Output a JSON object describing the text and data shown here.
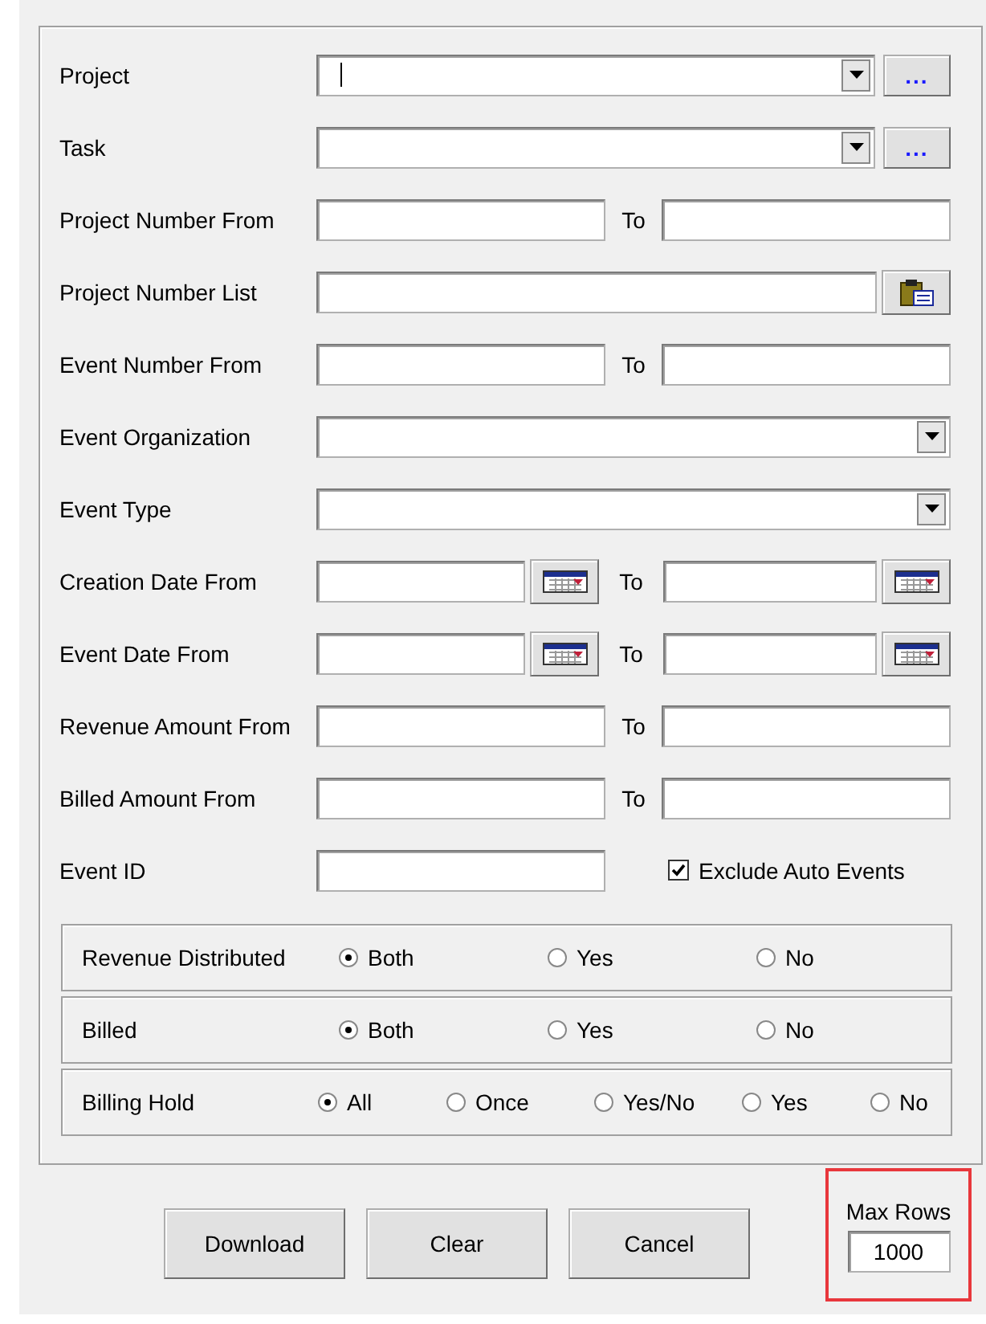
{
  "fields": [
    {
      "kind": "combo",
      "label": "Project",
      "browse": "...",
      "focused": true
    },
    {
      "kind": "combo",
      "label": "Task",
      "browse": "...",
      "focused": false
    },
    {
      "kind": "range",
      "label": "Project Number From",
      "to_label": "To",
      "focused": false
    },
    {
      "kind": "list",
      "label": "Project Number List",
      "focused": false
    },
    {
      "kind": "range",
      "label": "Event Number From",
      "to_label": "To",
      "focused": false
    },
    {
      "kind": "combo",
      "label": "Event Organization",
      "focused": false
    },
    {
      "kind": "combo",
      "label": "Event Type",
      "focused": false
    },
    {
      "kind": "date_range",
      "label": "Creation Date From",
      "to_label": "To",
      "focused": false
    },
    {
      "kind": "date_range",
      "label": "Event Date From",
      "to_label": "To",
      "focused": false
    },
    {
      "kind": "range",
      "label": "Revenue Amount From",
      "to_label": "To",
      "focused": false
    },
    {
      "kind": "range",
      "label": "Billed Amount From",
      "to_label": "To",
      "focused": false
    },
    {
      "kind": "single",
      "label": "Event ID",
      "focused": false,
      "checkbox": {
        "label": "Exclude Auto Events",
        "checked": true
      }
    }
  ],
  "radio_groups": [
    {
      "label": "Revenue Distributed",
      "options": [
        {
          "label": "Both",
          "selected": true
        },
        {
          "label": "Yes",
          "selected": false
        },
        {
          "label": "No",
          "selected": false
        }
      ]
    },
    {
      "label": "Billed",
      "options": [
        {
          "label": "Both",
          "selected": true
        },
        {
          "label": "Yes",
          "selected": false
        },
        {
          "label": "No",
          "selected": false
        }
      ]
    },
    {
      "label": "Billing Hold",
      "options": [
        {
          "label": "All",
          "selected": true
        },
        {
          "label": "Once",
          "selected": false
        },
        {
          "label": "Yes/No",
          "selected": false
        },
        {
          "label": "Yes",
          "selected": false
        },
        {
          "label": "No",
          "selected": false
        }
      ]
    }
  ],
  "buttons": [
    "Download",
    "Clear",
    "Cancel"
  ],
  "max_rows": {
    "label": "Max Rows",
    "value": "1000",
    "highlighted": true
  }
}
